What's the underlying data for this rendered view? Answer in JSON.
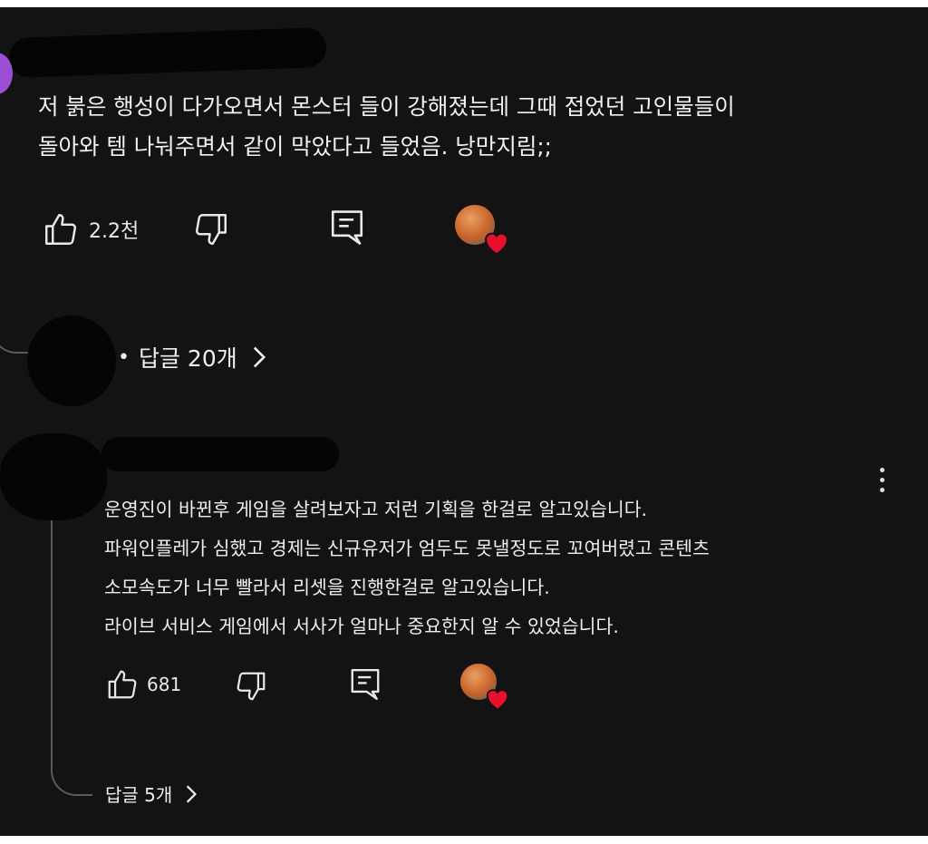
{
  "comment1": {
    "text": "저 붉은 행성이 다가오면서 몬스터 들이 강해졌는데 그때 접었던 고인물들이\n돌아와 템 나눠주면서 같이 막았다고 들었음. 낭만지림;;",
    "likes": "2.2천",
    "replies_label": "답글 20개",
    "replies_bullet": "•"
  },
  "comment2": {
    "text": "운영진이 바뀐후 게임을 살려보자고 저런 기획을 한걸로 알고있습니다.\n파워인플레가 심했고 경제는 신규유저가 엄두도 못낼정도로 꼬여버렸고 콘텐츠\n소모속도가 너무 빨라서 리셋을 진행한걸로 알고있습니다.\n라이브 서비스 게임에서 서사가 얼마나 중요한지 알 수 있었습니다.",
    "likes": "681",
    "replies_label": "답글 5개"
  },
  "icons": [
    "thumb-up-icon",
    "thumb-down-icon",
    "reply-icon",
    "creator-heart-icon",
    "chevron-right-icon",
    "more-vert-icon"
  ],
  "colors": {
    "background": "#131313",
    "text": "#f1f1f1",
    "heart": "#e8112d",
    "avatar": "#9c4fd6"
  }
}
